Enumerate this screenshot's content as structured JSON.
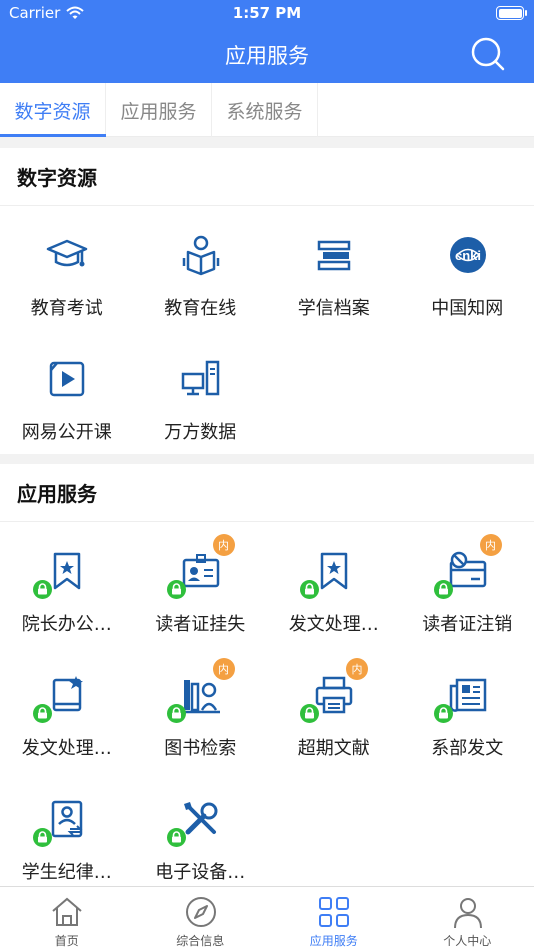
{
  "status": {
    "carrier": "Carrier",
    "time": "1:57 PM"
  },
  "header": {
    "title": "应用服务"
  },
  "tabs": [
    {
      "label": "数字资源",
      "active": true
    },
    {
      "label": "应用服务",
      "active": false
    },
    {
      "label": "系统服务",
      "active": false
    }
  ],
  "digital": {
    "title": "数字资源",
    "items": [
      {
        "label": "教育考试",
        "icon": "graduation-cap-icon"
      },
      {
        "label": "教育在线",
        "icon": "reader-icon"
      },
      {
        "label": "学信档案",
        "icon": "book-stack-icon"
      },
      {
        "label": "中国知网",
        "icon": "cnki-logo-icon"
      },
      {
        "label": "网易公开课",
        "icon": "video-play-icon"
      },
      {
        "label": "万方数据",
        "icon": "computer-icon"
      }
    ]
  },
  "apps": {
    "title": "应用服务",
    "badge_text": "内",
    "items": [
      {
        "label": "院长办公…",
        "icon": "bookmark-star-icon",
        "locked": true,
        "internal": false
      },
      {
        "label": "读者证挂失",
        "icon": "id-card-icon",
        "locked": true,
        "internal": true
      },
      {
        "label": "发文处理…",
        "icon": "bookmark-star-icon",
        "locked": true,
        "internal": false
      },
      {
        "label": "读者证注销",
        "icon": "card-cancel-icon",
        "locked": true,
        "internal": true
      },
      {
        "label": "发文处理…",
        "icon": "book-mark-icon",
        "locked": true,
        "internal": false
      },
      {
        "label": "图书检索",
        "icon": "library-search-icon",
        "locked": true,
        "internal": true
      },
      {
        "label": "超期文献",
        "icon": "printer-icon",
        "locked": true,
        "internal": true
      },
      {
        "label": "系部发文",
        "icon": "newspaper-icon",
        "locked": true,
        "internal": false
      },
      {
        "label": "学生纪律…",
        "icon": "student-card-icon",
        "locked": true,
        "internal": false
      },
      {
        "label": "电子设备…",
        "icon": "tools-icon",
        "locked": true,
        "internal": false
      }
    ]
  },
  "tabbar": [
    {
      "label": "首页",
      "icon": "home-icon",
      "active": false
    },
    {
      "label": "综合信息",
      "icon": "compass-icon",
      "active": false
    },
    {
      "label": "应用服务",
      "icon": "grid-icon",
      "active": true
    },
    {
      "label": "个人中心",
      "icon": "person-icon",
      "active": false
    }
  ],
  "colors": {
    "primary": "#3f7ef5",
    "icon_blue": "#1d5ea8",
    "lock_green": "#2fbf3c",
    "badge_orange": "#f4a042"
  }
}
